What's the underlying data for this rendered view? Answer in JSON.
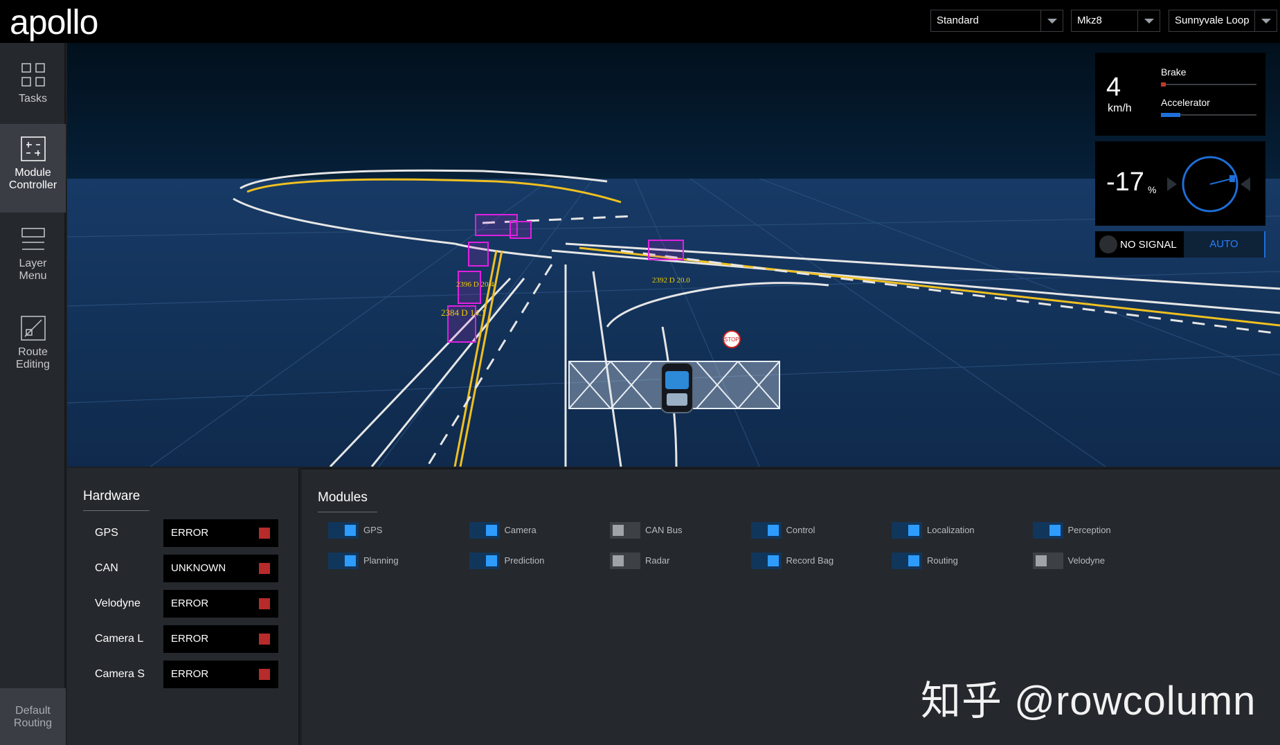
{
  "header": {
    "logo": "apollo",
    "mode": "Standard",
    "vehicle": "Mkz8",
    "map": "Sunnyvale Loop"
  },
  "sidebar": {
    "items": [
      {
        "label1": "Tasks",
        "label2": "",
        "icon": "grid-icon"
      },
      {
        "label1": "Module",
        "label2": "Controller",
        "icon": "sliders-icon",
        "active": true
      },
      {
        "label1": "Layer",
        "label2": "Menu",
        "icon": "layers-icon"
      },
      {
        "label1": "Route",
        "label2": "Editing",
        "icon": "route-icon"
      }
    ],
    "bottom": {
      "label1": "Default",
      "label2": "Routing"
    }
  },
  "scene": {
    "obstacles": [
      {
        "label": "2396  D 20.4"
      },
      {
        "label": "2384  D 14.1"
      },
      {
        "label": "2392  D 20.0"
      }
    ],
    "stop_sign": "STOP"
  },
  "dashboard": {
    "speed": "4",
    "speed_unit": "km/h",
    "brake_label": "Brake",
    "brake_level": 0.05,
    "accelerator_label": "Accelerator",
    "accelerator_level": 0.2,
    "steering": "-17",
    "steering_unit": "%",
    "signal": "NO SIGNAL",
    "drive_mode": "AUTO",
    "colors": {
      "brake": "#c0392b",
      "accelerator": "#1e6fd9",
      "accent": "#2a7fff"
    }
  },
  "hardware": {
    "title": "Hardware",
    "rows": [
      {
        "name": "GPS",
        "status": "ERROR"
      },
      {
        "name": "CAN",
        "status": "UNKNOWN"
      },
      {
        "name": "Velodyne",
        "status": "ERROR"
      },
      {
        "name": "Camera L",
        "status": "ERROR"
      },
      {
        "name": "Camera S",
        "status": "ERROR"
      }
    ]
  },
  "modules": {
    "title": "Modules",
    "items": [
      {
        "name": "GPS",
        "on": true
      },
      {
        "name": "Camera",
        "on": true
      },
      {
        "name": "CAN Bus",
        "on": false
      },
      {
        "name": "Control",
        "on": true
      },
      {
        "name": "Localization",
        "on": true
      },
      {
        "name": "Perception",
        "on": true
      },
      {
        "name": "Planning",
        "on": true
      },
      {
        "name": "Prediction",
        "on": true
      },
      {
        "name": "Radar",
        "on": false
      },
      {
        "name": "Record Bag",
        "on": true
      },
      {
        "name": "Routing",
        "on": true
      },
      {
        "name": "Velodyne",
        "on": false
      }
    ]
  },
  "watermark": "知乎 @rowcolumn"
}
